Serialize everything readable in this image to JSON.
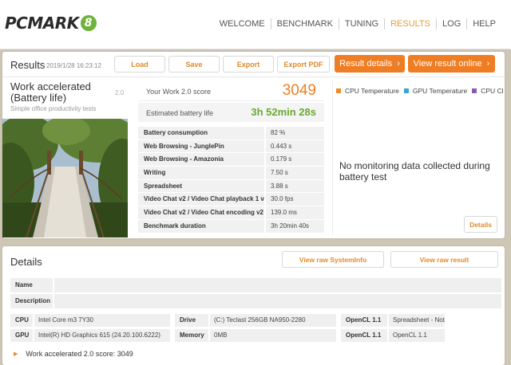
{
  "app": {
    "logo_text": "PCMARK",
    "logo_badge": "8"
  },
  "nav": [
    "WELCOME",
    "BENCHMARK",
    "TUNING",
    "RESULTS",
    "LOG",
    "HELP"
  ],
  "nav_active_index": 3,
  "results": {
    "title": "Results",
    "date": "2019/1/28 16:23:12",
    "buttons": {
      "load": "Load",
      "save": "Save",
      "export": "Export",
      "export_pdf": "Export PDF"
    },
    "result_details": "Result details",
    "view_online": "View result online",
    "test_name": "Work accelerated (Battery life)",
    "test_version": "2.0",
    "test_subtitle": "Simple office productivity tests",
    "score_label": "Your Work 2.0 score",
    "score_value": "3049",
    "battery_label": "Estimated battery life",
    "battery_value": "3h 52min 28s",
    "subscores": [
      {
        "name": "Battery consumption",
        "value": "82 %"
      },
      {
        "name": "Web Browsing - JunglePin",
        "value": "0.443 s"
      },
      {
        "name": "Web Browsing - Amazonia",
        "value": "0.179 s"
      },
      {
        "name": "Writing",
        "value": "7.50 s"
      },
      {
        "name": "Spreadsheet",
        "value": "3.88 s"
      },
      {
        "name": "Video Chat v2 / Video Chat playback 1 v",
        "value": "30.0 fps"
      },
      {
        "name": "Video Chat v2 / Video Chat encoding v2",
        "value": "139.0 ms"
      },
      {
        "name": "Benchmark duration",
        "value": "3h 20min 40s"
      }
    ]
  },
  "monitoring": {
    "legend": [
      {
        "label": "CPU Temperature",
        "color": "#f08a2a"
      },
      {
        "label": "GPU Temperature",
        "color": "#3ba3d8"
      },
      {
        "label": "CPU Clc",
        "color": "#8a5ab0"
      }
    ],
    "no_data": "No monitoring data collected during battery test",
    "details_button": "Details"
  },
  "details": {
    "title": "Details",
    "view_sysinfo": "View raw SystemInfo",
    "view_result": "View raw result",
    "name_label": "Name",
    "description_label": "Description",
    "specs": {
      "cpu_label": "CPU",
      "cpu_value": "Intel Core m3 7Y30",
      "gpu_label": "GPU",
      "gpu_value": "Intel(R) HD Graphics 615 (24.20.100.6222)",
      "drive_label": "Drive",
      "drive_value": "(C:) Teclast 256GB NA950-2280",
      "memory_label": "Memory",
      "memory_value": "0MB",
      "opencl1_label": "OpenCL 1.1",
      "opencl1_value": "Spreadsheet - Not in use",
      "opencl2_label": "OpenCL 1.1",
      "opencl2_value": "OpenCL 1.1"
    },
    "summary": "Work accelerated 2.0 score: 3049"
  }
}
